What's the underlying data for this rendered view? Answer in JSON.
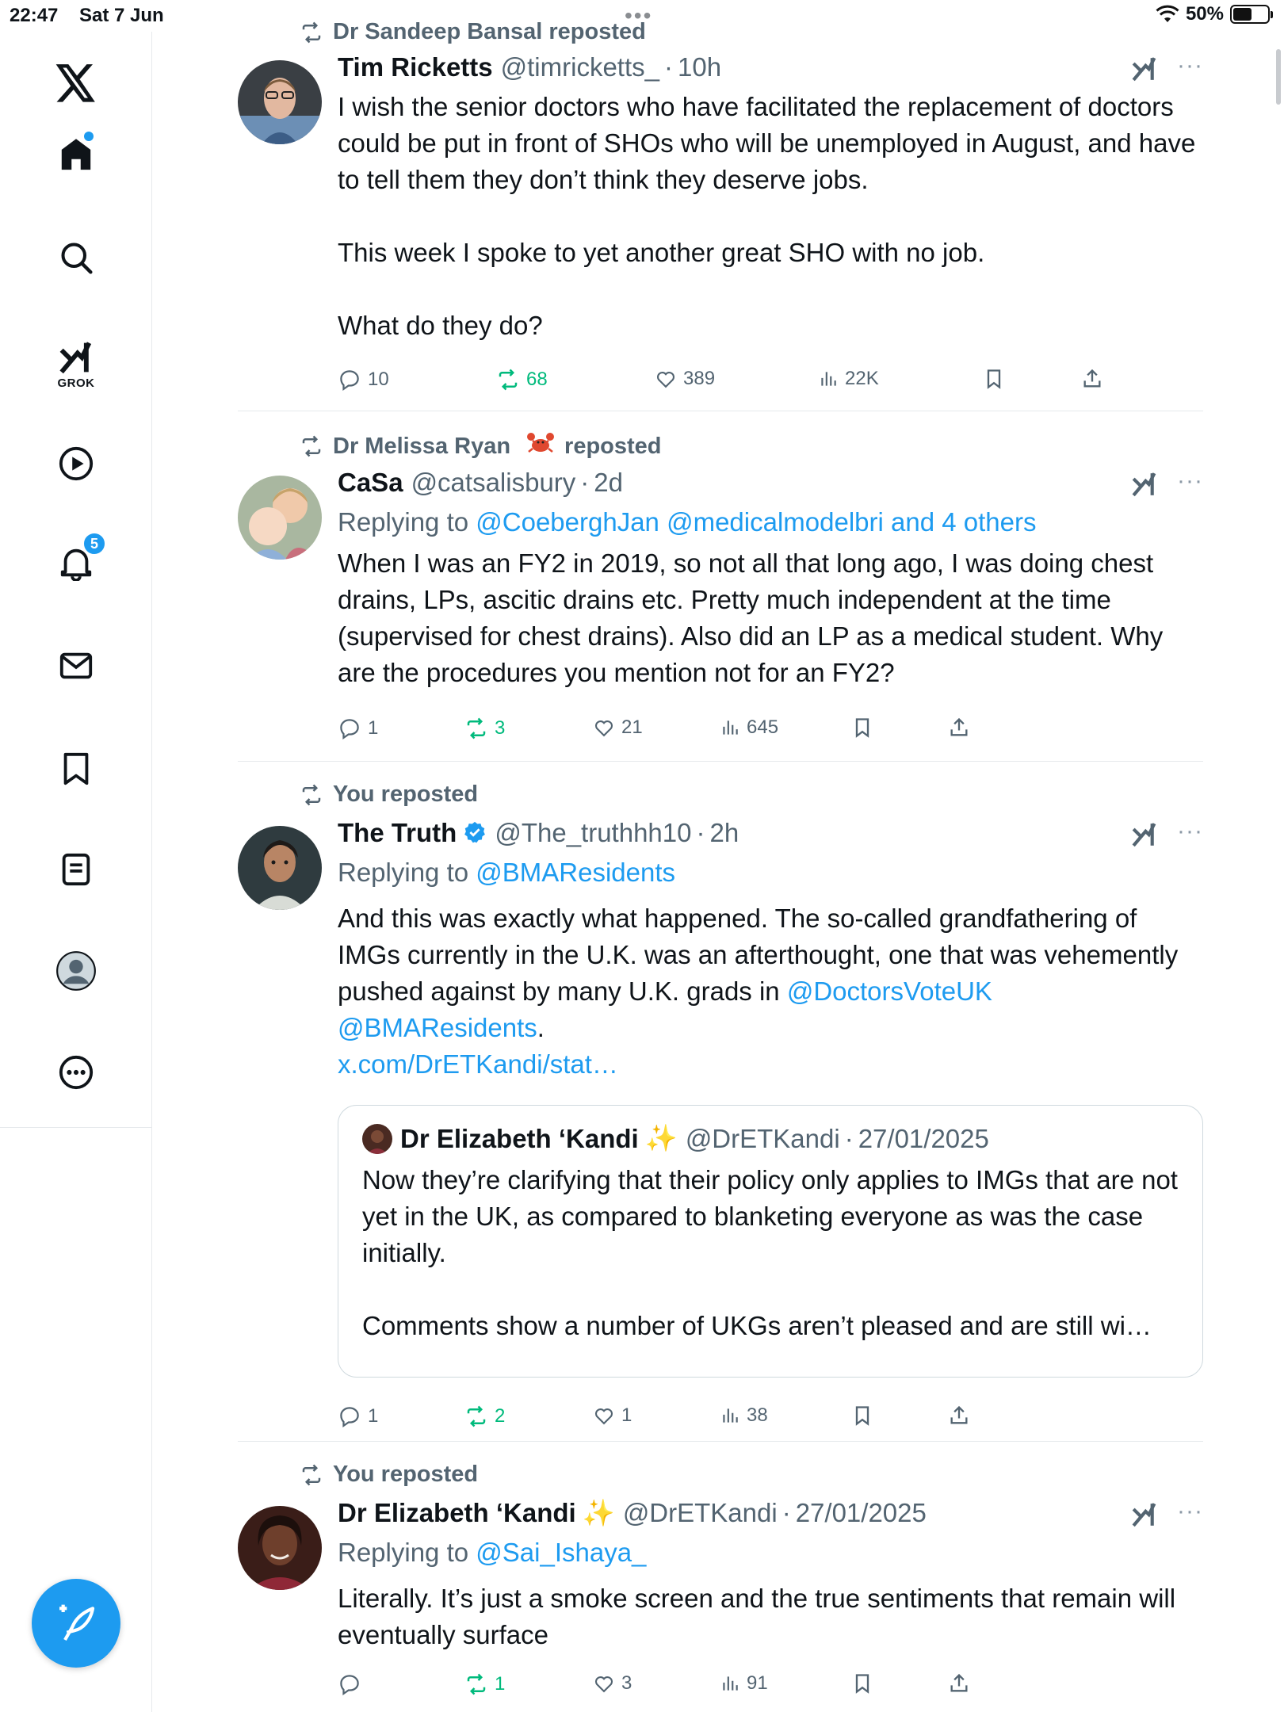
{
  "status": {
    "time": "22:47",
    "date": "Sat 7 Jun",
    "battery": "50%"
  },
  "sidebar": {
    "grok_label": "GROK",
    "notifications_badge": "5",
    "items": [
      "x-logo-icon",
      "home-icon",
      "search-icon",
      "grok-icon",
      "video-icon",
      "notifications-icon",
      "messages-icon",
      "bookmarks-icon",
      "lists-icon",
      "profile-icon",
      "more-icon"
    ]
  },
  "colors": {
    "accent": "#1d9bf0",
    "repost": "#00ba7c",
    "muted": "#536471"
  },
  "tweets": [
    {
      "repost_by": "Dr Sandeep Bansal reposted",
      "name": "Tim Ricketts",
      "handle": "@timricketts_",
      "sep": "·",
      "time": "10h",
      "text": "I wish the senior doctors who have facilitated the replacement of doctors could be put in front of SHOs who will be unemployed in August, and have to tell them they don’t think they deserve jobs.\n\nThis week I spoke to yet another great SHO with no job.\n\nWhat do they do?",
      "replies": "10",
      "reposts": "68",
      "likes": "389",
      "views": "22K"
    },
    {
      "repost_by_name": "Dr Melissa Ryan",
      "repost_by_suffix": "reposted",
      "name": "CaSa",
      "handle": "@catsalisbury",
      "sep": "·",
      "time": "2d",
      "reply_prefix": "Replying to ",
      "reply_targets": "@CoeberghJan @medicalmodelbri and 4 others",
      "text": "When I was an FY2 in 2019, so not all that long ago, I was doing chest drains, LPs, ascitic drains etc. Pretty much independent at the time (supervised for chest drains). Also did an LP as a medical student. Why are the procedures you mention not for an FY2?",
      "replies": "1",
      "reposts": "3",
      "likes": "21",
      "views": "645"
    },
    {
      "repost_by": "You reposted",
      "name": "The Truth",
      "handle": "@The_truthhh10",
      "sep": "·",
      "time": "2h",
      "reply_prefix": "Replying to ",
      "reply_targets": "@BMAResidents",
      "text_a": "And this was exactly what happened. The so-called grandfathering of IMGs currently in the U.K. was an afterthought, one that was vehemently pushed against by many U.K. grads in ",
      "text_link1": "@DoctorsVoteUK",
      "text_link2": "@BMAResidents",
      "text_dot": ".",
      "text_link3": "x.com/DrETKandi/stat…",
      "quote": {
        "name": "Dr Elizabeth ‘Kandi",
        "sparkle": "✨",
        "handle": "@DrETKandi",
        "sep": "·",
        "time": "27/01/2025",
        "text": "Now they’re clarifying that their policy only applies to IMGs that are not yet in the UK, as compared to blanketing everyone as was the case initially.\n\nComments show a number of UKGs aren’t pleased and are still wi…"
      },
      "replies": "1",
      "reposts": "2",
      "likes": "1",
      "views": "38"
    },
    {
      "repost_by": "You reposted",
      "name": "Dr Elizabeth ‘Kandi",
      "sparkle": "✨",
      "handle": "@DrETKandi",
      "sep": "·",
      "time": "27/01/2025",
      "reply_prefix": "Replying to ",
      "reply_targets": "@Sai_Ishaya_",
      "text": "Literally. It’s just a smoke screen and the true sentiments that remain will eventually surface",
      "reposts": "1",
      "likes": "3",
      "views": "91"
    }
  ]
}
